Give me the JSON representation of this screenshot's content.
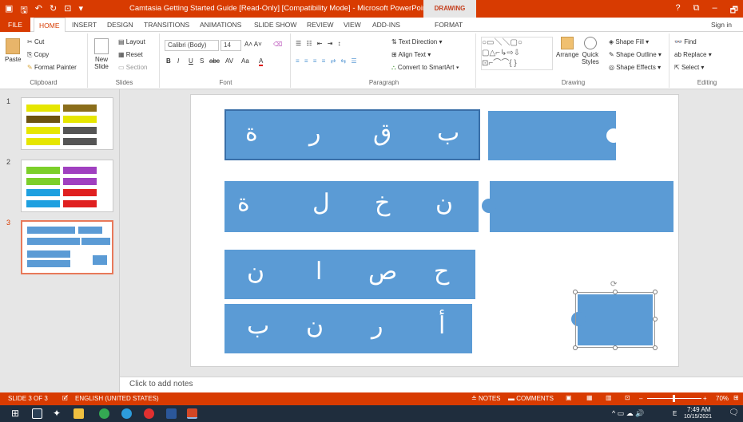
{
  "titlebar": {
    "title": "Camtasia Getting Started Guide [Read-Only] [Compatibility Mode] - Microsoft PowerPoint",
    "contextual_tab_group": "DRAWING TOOLS",
    "help": "?",
    "restore_ribbon": "⧉",
    "minimize": "–",
    "maximize": "🗗"
  },
  "tabs": {
    "file": "FILE",
    "home": "HOME",
    "insert": "INSERT",
    "design": "DESIGN",
    "transitions": "TRANSITIONS",
    "animations": "ANIMATIONS",
    "slide_show": "SLIDE SHOW",
    "review": "REVIEW",
    "view": "VIEW",
    "add_ins": "ADD-INS",
    "format": "FORMAT",
    "sign_in": "Sign in"
  },
  "ribbon": {
    "clipboard": {
      "label": "Clipboard",
      "paste": "Paste",
      "cut": "Cut",
      "copy": "Copy",
      "format_painter": "Format Painter"
    },
    "slides": {
      "label": "Slides",
      "new_slide_line1": "New",
      "new_slide_line2": "Slide",
      "layout": "Layout",
      "reset": "Reset",
      "section": "Section"
    },
    "font": {
      "label": "Font",
      "font_name": "Calibri (Body)",
      "font_size": "14",
      "bold": "B",
      "italic": "I",
      "underline": "U",
      "strike": "S",
      "shadow": "abc",
      "spacing": "AV",
      "case": "Aa",
      "color": "A"
    },
    "paragraph": {
      "label": "Paragraph",
      "text_direction": "Text Direction",
      "align_text": "Align Text",
      "convert_smartart": "Convert to SmartArt"
    },
    "drawing": {
      "label": "Drawing",
      "arrange": "Arrange",
      "quick_styles_line1": "Quick",
      "quick_styles_line2": "Styles",
      "shape_fill": "Shape Fill",
      "shape_outline": "Shape Outline",
      "shape_effects": "Shape Effects"
    },
    "editing": {
      "label": "Editing",
      "find": "Find",
      "replace": "Replace",
      "select": "Select"
    }
  },
  "thumbnails": [
    {
      "number": "1"
    },
    {
      "number": "2"
    },
    {
      "number": "3"
    }
  ],
  "slide": {
    "row1": [
      "ة",
      "ر",
      "ق",
      "ب"
    ],
    "row2": [
      "ة",
      "ل",
      "خ",
      "ن"
    ],
    "row3": [
      "ن",
      "ا",
      "ص",
      "ح"
    ],
    "row4": [
      "ب",
      "ن",
      "ر",
      "أ"
    ]
  },
  "notes_placeholder": "Click to add notes",
  "status": {
    "slide_info": "SLIDE 3 OF 3",
    "language": "ENGLISH (UNITED STATES)",
    "notes": "NOTES",
    "comments": "COMMENTS",
    "zoom": "70%"
  },
  "taskbar": {
    "time": "7:49 AM",
    "date": "10/15/2021",
    "lang": "E"
  },
  "colors": {
    "accent": "#d83b01",
    "piece": "#5b9bd5",
    "taskbar": "#1f2d3d"
  }
}
